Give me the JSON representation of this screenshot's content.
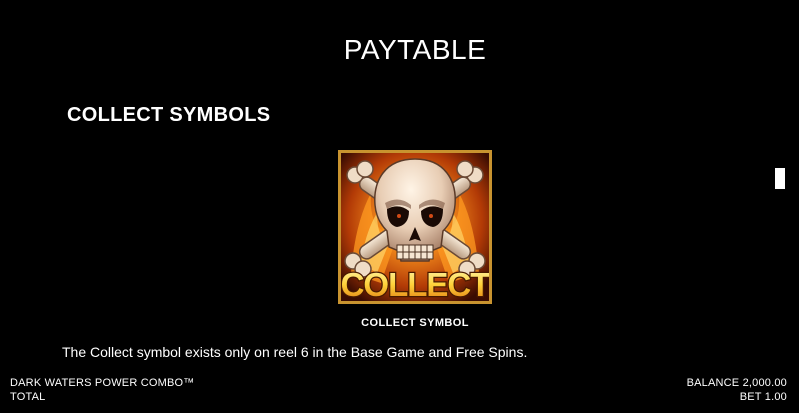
{
  "header": {
    "title": "PAYTABLE"
  },
  "section": {
    "heading": "COLLECT SYMBOLS"
  },
  "symbol": {
    "badge_text": "COLLECT",
    "icon": "flaming-skull-crossbones-icon",
    "caption": "COLLECT SYMBOL",
    "description": "The Collect symbol exists only on reel 6 in the Base Game and Free Spins."
  },
  "footer": {
    "game_name": "DARK WATERS POWER COMBO™",
    "total_label": "TOTAL",
    "balance": "BALANCE 2,000.00",
    "bet": "BET 1.00"
  },
  "colors": {
    "background": "#000000",
    "text": "#ffffff",
    "tile_border": "#c8932f",
    "collect_text": "#ffd23a"
  }
}
